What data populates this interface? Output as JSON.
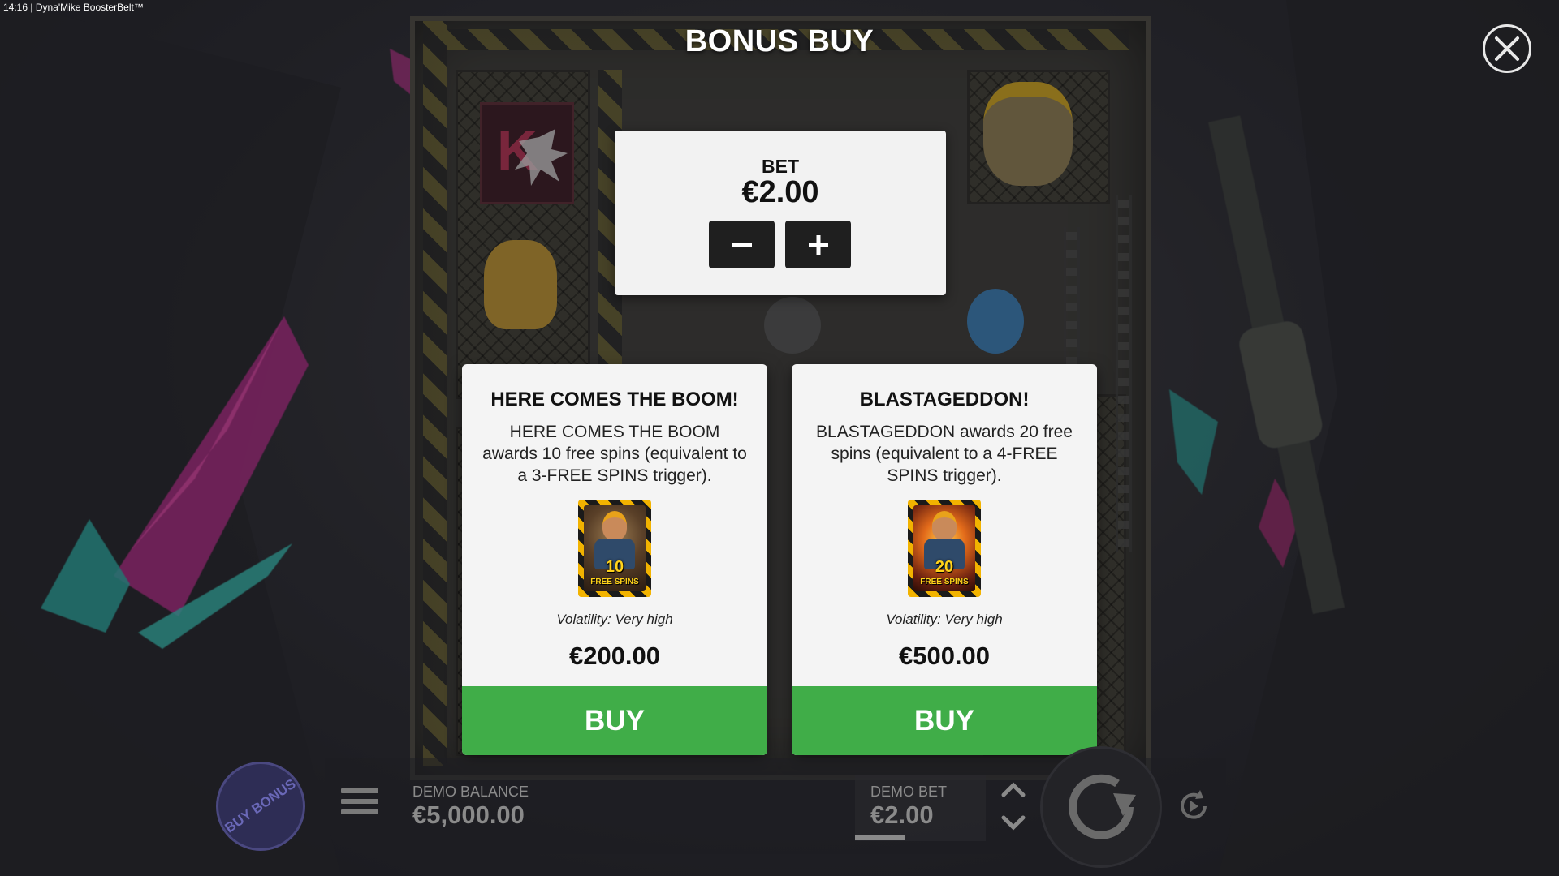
{
  "status_bar": {
    "time": "14:16",
    "game_name": "Dyna'Mike BoosterBelt™"
  },
  "header": {
    "title": "BONUS BUY"
  },
  "bet_panel": {
    "label": "BET",
    "value": "€2.00",
    "decrease_icon": "minus-icon",
    "increase_icon": "plus-icon"
  },
  "offers": [
    {
      "title": "HERE COMES THE BOOM!",
      "description": "HERE COMES THE BOOM awards 10 free spins (equivalent to a 3-FREE SPINS trigger).",
      "image_number": "10",
      "image_caption": "FREE SPINS",
      "volatility": "Volatility: Very high",
      "price": "€200.00",
      "buy_label": "BUY"
    },
    {
      "title": "BLASTAGEDDON!",
      "description": "BLASTAGEDDON awards 20 free spins (equivalent to a 4-FREE SPINS trigger).",
      "image_number": "20",
      "image_caption": "FREE SPINS",
      "volatility": "Volatility: Very high",
      "price": "€500.00",
      "buy_label": "BUY"
    }
  ],
  "hud": {
    "buy_bonus_label": "BUY BONUS",
    "balance_label": "DEMO BALANCE",
    "balance_value": "€5,000.00",
    "bet_label": "DEMO BET",
    "bet_value": "€2.00",
    "icons": [
      "menu-icon",
      "chevron-up-icon",
      "chevron-down-icon",
      "spin-icon",
      "autoplay-icon",
      "close-icon"
    ]
  },
  "colors": {
    "buy_button": "#40ad48",
    "panel_bg": "#f4f4f4",
    "buy_bonus_circle": "#2e2d55"
  }
}
